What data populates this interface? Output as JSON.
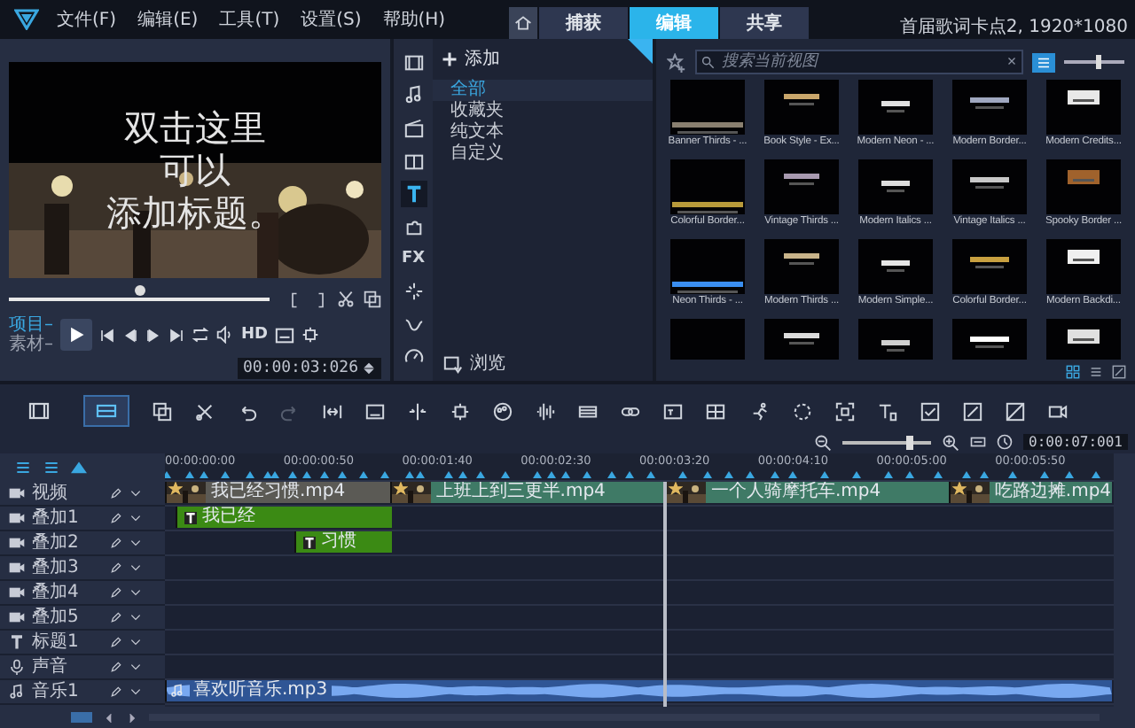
{
  "menu": [
    "文件(F)",
    "编辑(E)",
    "工具(T)",
    "设置(S)",
    "帮助(H)"
  ],
  "tabs": [
    {
      "label": "捕获",
      "selected": false
    },
    {
      "label": "编辑",
      "selected": true
    },
    {
      "label": "共享",
      "selected": false
    }
  ],
  "project_info": "首届歌词卡点2, 1920*1080",
  "preview": {
    "title_lines": [
      "双击这里",
      "可以",
      "添加标题。"
    ],
    "scrubber": {
      "level": 0.5
    },
    "modes": [
      {
        "label": "项目–",
        "selected": true
      },
      {
        "label": "素材–",
        "selected": false
      }
    ],
    "hd_label": "HD",
    "timecode": "00:00:03:026"
  },
  "library": {
    "tabs": [
      {
        "selected": false
      },
      {
        "selected": false
      },
      {
        "selected": false
      },
      {
        "selected": false
      },
      {
        "selected": true
      },
      {
        "selected": false
      },
      {
        "selected": false,
        "label": "FX"
      },
      {
        "selected": false
      },
      {
        "selected": false
      },
      {
        "selected": false
      }
    ],
    "add_label": "添加",
    "categories": [
      {
        "label": "全部",
        "selected": true
      },
      {
        "label": "收藏夹",
        "selected": false
      },
      {
        "label": "纯文本",
        "selected": false
      },
      {
        "label": "自定义",
        "selected": false
      }
    ],
    "browse_label": "浏览"
  },
  "gallery": {
    "search": {
      "placeholder": "搜索当前视图"
    },
    "list_toggle": {
      "on": true
    },
    "size_slider": {
      "level": 0.55
    },
    "templates": [
      {
        "label": "Banner Thirds - ..."
      },
      {
        "label": "Book Style - Ex..."
      },
      {
        "label": "Modern Neon - ..."
      },
      {
        "label": "Modern Border..."
      },
      {
        "label": "Modern Credits..."
      },
      {
        "label": "Colorful Border..."
      },
      {
        "label": "Vintage Thirds ..."
      },
      {
        "label": "Modern Italics ..."
      },
      {
        "label": "Vintage Italics ..."
      },
      {
        "label": "Spooky Border ..."
      },
      {
        "label": "Neon Thirds - ..."
      },
      {
        "label": "Modern Thirds ..."
      },
      {
        "label": "Modern Simple..."
      },
      {
        "label": "Colorful Border..."
      },
      {
        "label": "Modern Backdi..."
      },
      {
        "kind": "picture"
      },
      {
        "kind": "picture"
      },
      {
        "kind": "picture"
      },
      {
        "kind": "picture"
      },
      {
        "kind": "picture"
      }
    ],
    "view_buttons": [
      {
        "selected": true
      },
      {
        "selected": false
      },
      {
        "selected": false
      }
    ]
  },
  "timeline": {
    "view_modes": [
      {
        "selected": false
      },
      {
        "selected": true
      }
    ],
    "toolbar": [
      {
        "disabled": false
      },
      {
        "disabled": false
      },
      {
        "disabled": false
      },
      {
        "disabled": true
      },
      {
        "disabled": false
      },
      {
        "disabled": false
      },
      {
        "disabled": false
      },
      {
        "disabled": false
      },
      {
        "disabled": false
      },
      {
        "disabled": false
      },
      {
        "disabled": false
      },
      {
        "disabled": false
      },
      {
        "disabled": false
      },
      {
        "disabled": false
      },
      {
        "disabled": false
      },
      {
        "disabled": false
      },
      {
        "disabled": false
      },
      {
        "disabled": false
      },
      {
        "disabled": false
      },
      {
        "disabled": false
      },
      {
        "disabled": false
      },
      {
        "disabled": false
      }
    ],
    "zoom": {
      "level": 0.75
    },
    "duration": "0:00:07:001",
    "ruler": [
      "00:00:00:00",
      "00:00:00:50",
      "00:00:01:40",
      "00:00:02:30",
      "00:00:03:20",
      "00:00:04:10",
      "00:00:05:00",
      "00:00:05:50"
    ],
    "playhead": {
      "level": 0.527
    },
    "tracks": [
      {
        "kind": "video",
        "name": "视频",
        "clips": [
          {
            "kind": "video",
            "label": "我已经习惯.mp4",
            "color": "#5b5a55"
          },
          {
            "kind": "video",
            "label": "上班上到三更半.mp4",
            "color": "#3f7a66"
          },
          {
            "kind": "video",
            "label": "一个人骑摩托车.mp4",
            "color": "#3f7a66"
          },
          {
            "kind": "video",
            "label": "吃路边摊.mp4",
            "color": "#3f7a66"
          }
        ]
      },
      {
        "kind": "overlay",
        "name": "叠加1",
        "clips": [
          {
            "kind": "title",
            "label": "我已经",
            "color": "#3b8a14"
          }
        ]
      },
      {
        "kind": "overlay",
        "name": "叠加2",
        "clips": [
          {
            "kind": "title",
            "label": "习惯",
            "color": "#3b8a14"
          }
        ]
      },
      {
        "kind": "overlay",
        "name": "叠加3"
      },
      {
        "kind": "overlay",
        "name": "叠加4"
      },
      {
        "kind": "overlay",
        "name": "叠加5"
      },
      {
        "kind": "title",
        "name": "标题1"
      },
      {
        "kind": "voice",
        "name": "声音"
      },
      {
        "kind": "music",
        "name": "音乐1",
        "clips": [
          {
            "kind": "audio",
            "label": "喜欢听音乐.mp3",
            "color": "#2f5595"
          }
        ]
      }
    ]
  }
}
